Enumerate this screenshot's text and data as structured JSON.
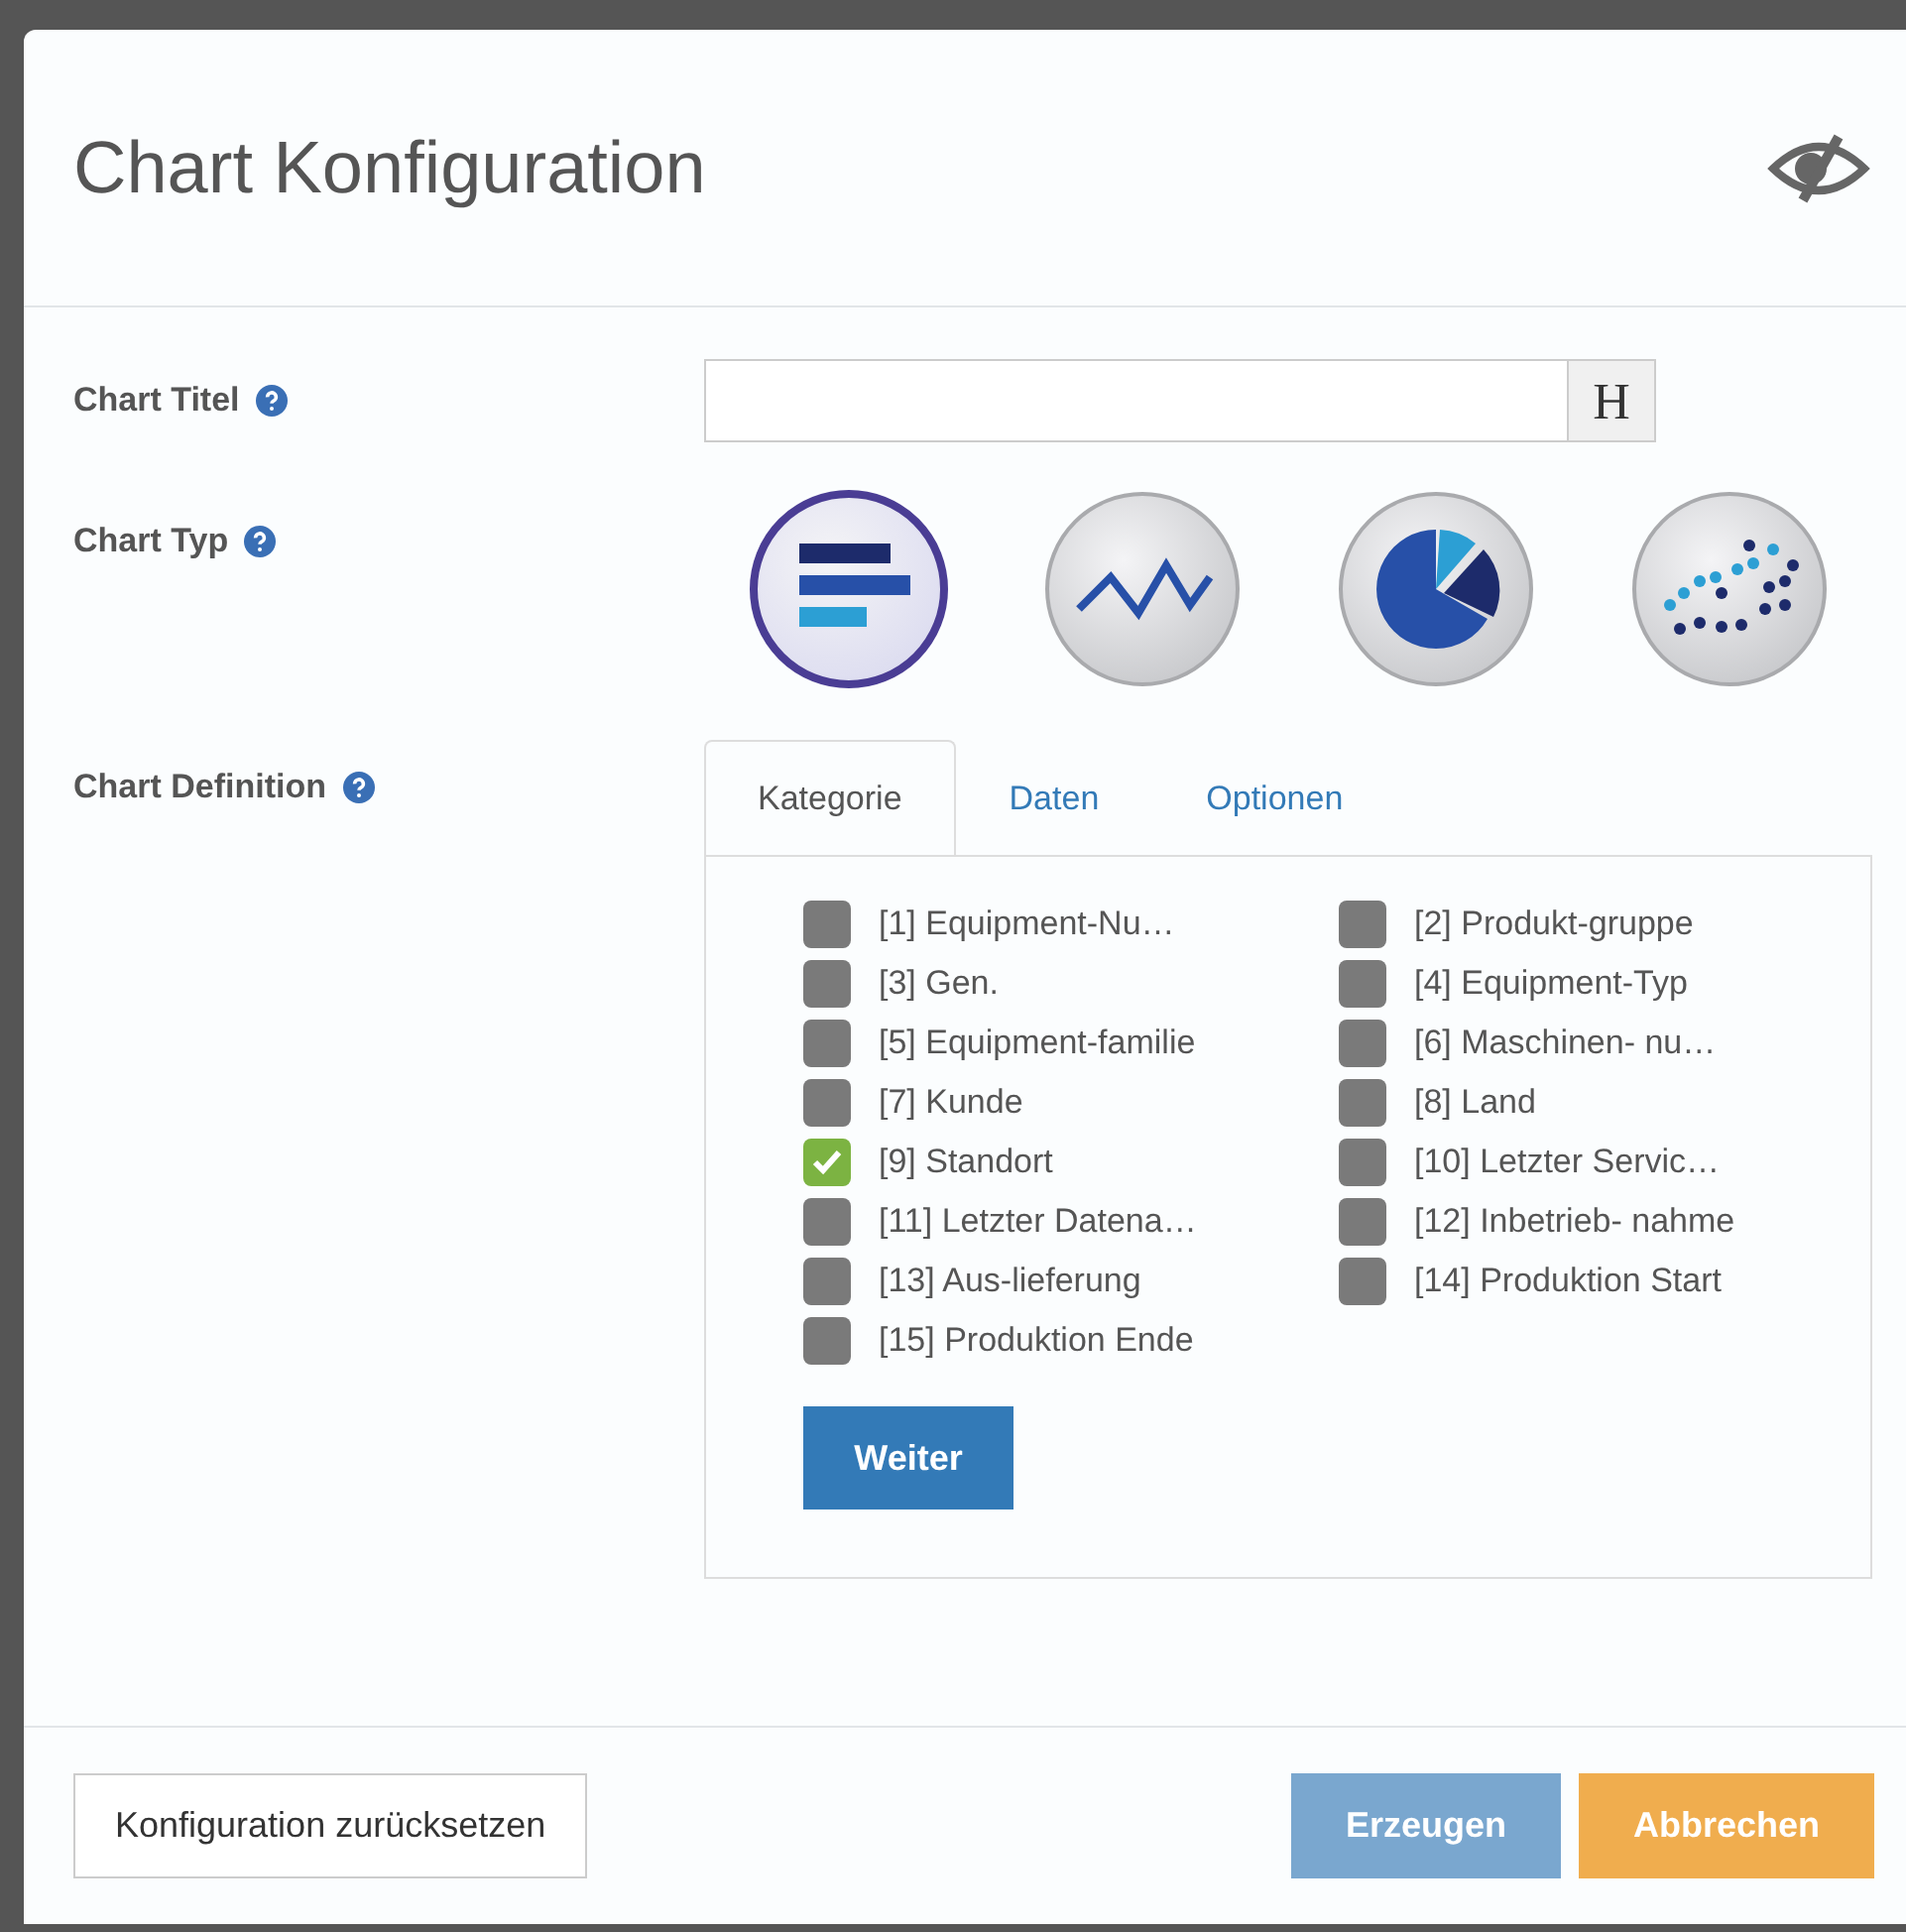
{
  "dialog": {
    "title": "Chart Konfiguration"
  },
  "fields": [
    {
      "kind": "title",
      "label": "Chart Titel"
    },
    {
      "kind": "types",
      "label": "Chart Typ",
      "types": [
        {
          "kind": "bar",
          "selected": true
        },
        {
          "kind": "line",
          "selected": false
        },
        {
          "kind": "pie",
          "selected": false
        },
        {
          "kind": "scatter",
          "selected": false
        }
      ]
    },
    {
      "kind": "definition",
      "label": "Chart Definition"
    }
  ],
  "title_button": "H",
  "tabs": [
    {
      "label": "Kategorie",
      "selected": true
    },
    {
      "label": "Daten",
      "selected": false
    },
    {
      "label": "Optionen",
      "selected": false
    }
  ],
  "categories": [
    {
      "label": "[1] Equipment-Nu…",
      "checked": false
    },
    {
      "label": "[2] Produkt-gruppe",
      "checked": false
    },
    {
      "label": "[3] Gen.",
      "checked": false
    },
    {
      "label": "[4] Equipment-Typ",
      "checked": false
    },
    {
      "label": "[5] Equipment-familie",
      "checked": false
    },
    {
      "label": "[6] Maschinen- nu…",
      "checked": false
    },
    {
      "label": "[7] Kunde",
      "checked": false
    },
    {
      "label": "[8] Land",
      "checked": false
    },
    {
      "label": "[9] Standort",
      "checked": true
    },
    {
      "label": "[10] Letzter Servic…",
      "checked": false
    },
    {
      "label": "[11] Letzter Datena…",
      "checked": false
    },
    {
      "label": "[12] Inbetrieb- nahme",
      "checked": false
    },
    {
      "label": "[13] Aus-lieferung",
      "checked": false
    },
    {
      "label": "[14] Produktion Start",
      "checked": false
    },
    {
      "label": "[15] Produktion Ende",
      "checked": false
    }
  ],
  "next_button": "Weiter",
  "footer": {
    "reset": "Konfiguration zurücksetzen",
    "create": {
      "label": "Erzeugen",
      "disabled": true
    },
    "cancel": "Abbrechen"
  }
}
